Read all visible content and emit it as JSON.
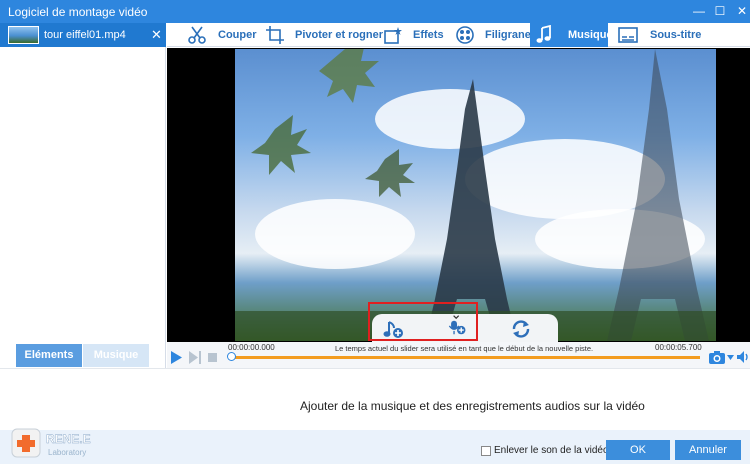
{
  "window": {
    "title": "Logiciel de montage vidéo",
    "controls": [
      "—",
      "☐",
      "✕"
    ]
  },
  "left_panel": {
    "file": {
      "name": "tour eiffel01.mp4",
      "close": "✕"
    },
    "tabs": [
      {
        "label": "Eléments",
        "active": true
      },
      {
        "label": "Musique",
        "active": false
      }
    ]
  },
  "toolbar": {
    "tabs": [
      {
        "label": "Couper",
        "icon": "scissors-icon",
        "active": false
      },
      {
        "label": "Pivoter et rogner",
        "icon": "rotate-crop-icon",
        "active": false
      },
      {
        "label": "Effets",
        "icon": "effects-icon",
        "active": false
      },
      {
        "label": "Filigranes",
        "icon": "watermark-icon",
        "active": false
      },
      {
        "label": "Musique",
        "icon": "music-note-icon",
        "active": true
      },
      {
        "label": "Sous-titre",
        "icon": "subtitle-icon",
        "active": false
      }
    ]
  },
  "player": {
    "time_start": "00:00:00.000",
    "time_end": "00:00:05.700",
    "hint": "Le temps actuel du slider sera utilisé en tant que le début de la nouvelle piste.",
    "progress": 0
  },
  "overlay_tools": [
    "add-music-icon",
    "add-recording-icon",
    "refresh-icon"
  ],
  "bottom": {
    "description": "Ajouter de la musique et des enregistrements audios sur la vidéo",
    "mute_label": "Enlever le son de la vidéo",
    "mute_checked": false,
    "ok": "OK",
    "cancel": "Annuler"
  },
  "logo": {
    "name": "RENE.E",
    "sub": "Laboratory"
  },
  "colors": {
    "accent": "#2e86de",
    "progress": "#f39c1f",
    "highlight": "#e02020"
  }
}
